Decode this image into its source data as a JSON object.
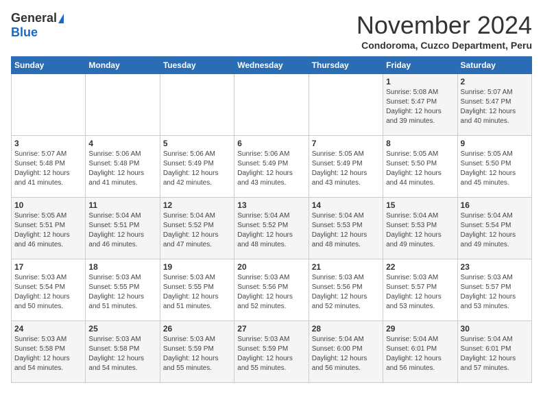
{
  "header": {
    "logo_general": "General",
    "logo_blue": "Blue",
    "month": "November 2024",
    "location": "Condoroma, Cuzco Department, Peru"
  },
  "days_of_week": [
    "Sunday",
    "Monday",
    "Tuesday",
    "Wednesday",
    "Thursday",
    "Friday",
    "Saturday"
  ],
  "weeks": [
    [
      {
        "day": "",
        "info": ""
      },
      {
        "day": "",
        "info": ""
      },
      {
        "day": "",
        "info": ""
      },
      {
        "day": "",
        "info": ""
      },
      {
        "day": "",
        "info": ""
      },
      {
        "day": "1",
        "info": "Sunrise: 5:08 AM\nSunset: 5:47 PM\nDaylight: 12 hours\nand 39 minutes."
      },
      {
        "day": "2",
        "info": "Sunrise: 5:07 AM\nSunset: 5:47 PM\nDaylight: 12 hours\nand 40 minutes."
      }
    ],
    [
      {
        "day": "3",
        "info": "Sunrise: 5:07 AM\nSunset: 5:48 PM\nDaylight: 12 hours\nand 41 minutes."
      },
      {
        "day": "4",
        "info": "Sunrise: 5:06 AM\nSunset: 5:48 PM\nDaylight: 12 hours\nand 41 minutes."
      },
      {
        "day": "5",
        "info": "Sunrise: 5:06 AM\nSunset: 5:49 PM\nDaylight: 12 hours\nand 42 minutes."
      },
      {
        "day": "6",
        "info": "Sunrise: 5:06 AM\nSunset: 5:49 PM\nDaylight: 12 hours\nand 43 minutes."
      },
      {
        "day": "7",
        "info": "Sunrise: 5:05 AM\nSunset: 5:49 PM\nDaylight: 12 hours\nand 43 minutes."
      },
      {
        "day": "8",
        "info": "Sunrise: 5:05 AM\nSunset: 5:50 PM\nDaylight: 12 hours\nand 44 minutes."
      },
      {
        "day": "9",
        "info": "Sunrise: 5:05 AM\nSunset: 5:50 PM\nDaylight: 12 hours\nand 45 minutes."
      }
    ],
    [
      {
        "day": "10",
        "info": "Sunrise: 5:05 AM\nSunset: 5:51 PM\nDaylight: 12 hours\nand 46 minutes."
      },
      {
        "day": "11",
        "info": "Sunrise: 5:04 AM\nSunset: 5:51 PM\nDaylight: 12 hours\nand 46 minutes."
      },
      {
        "day": "12",
        "info": "Sunrise: 5:04 AM\nSunset: 5:52 PM\nDaylight: 12 hours\nand 47 minutes."
      },
      {
        "day": "13",
        "info": "Sunrise: 5:04 AM\nSunset: 5:52 PM\nDaylight: 12 hours\nand 48 minutes."
      },
      {
        "day": "14",
        "info": "Sunrise: 5:04 AM\nSunset: 5:53 PM\nDaylight: 12 hours\nand 48 minutes."
      },
      {
        "day": "15",
        "info": "Sunrise: 5:04 AM\nSunset: 5:53 PM\nDaylight: 12 hours\nand 49 minutes."
      },
      {
        "day": "16",
        "info": "Sunrise: 5:04 AM\nSunset: 5:54 PM\nDaylight: 12 hours\nand 49 minutes."
      }
    ],
    [
      {
        "day": "17",
        "info": "Sunrise: 5:03 AM\nSunset: 5:54 PM\nDaylight: 12 hours\nand 50 minutes."
      },
      {
        "day": "18",
        "info": "Sunrise: 5:03 AM\nSunset: 5:55 PM\nDaylight: 12 hours\nand 51 minutes."
      },
      {
        "day": "19",
        "info": "Sunrise: 5:03 AM\nSunset: 5:55 PM\nDaylight: 12 hours\nand 51 minutes."
      },
      {
        "day": "20",
        "info": "Sunrise: 5:03 AM\nSunset: 5:56 PM\nDaylight: 12 hours\nand 52 minutes."
      },
      {
        "day": "21",
        "info": "Sunrise: 5:03 AM\nSunset: 5:56 PM\nDaylight: 12 hours\nand 52 minutes."
      },
      {
        "day": "22",
        "info": "Sunrise: 5:03 AM\nSunset: 5:57 PM\nDaylight: 12 hours\nand 53 minutes."
      },
      {
        "day": "23",
        "info": "Sunrise: 5:03 AM\nSunset: 5:57 PM\nDaylight: 12 hours\nand 53 minutes."
      }
    ],
    [
      {
        "day": "24",
        "info": "Sunrise: 5:03 AM\nSunset: 5:58 PM\nDaylight: 12 hours\nand 54 minutes."
      },
      {
        "day": "25",
        "info": "Sunrise: 5:03 AM\nSunset: 5:58 PM\nDaylight: 12 hours\nand 54 minutes."
      },
      {
        "day": "26",
        "info": "Sunrise: 5:03 AM\nSunset: 5:59 PM\nDaylight: 12 hours\nand 55 minutes."
      },
      {
        "day": "27",
        "info": "Sunrise: 5:03 AM\nSunset: 5:59 PM\nDaylight: 12 hours\nand 55 minutes."
      },
      {
        "day": "28",
        "info": "Sunrise: 5:04 AM\nSunset: 6:00 PM\nDaylight: 12 hours\nand 56 minutes."
      },
      {
        "day": "29",
        "info": "Sunrise: 5:04 AM\nSunset: 6:01 PM\nDaylight: 12 hours\nand 56 minutes."
      },
      {
        "day": "30",
        "info": "Sunrise: 5:04 AM\nSunset: 6:01 PM\nDaylight: 12 hours\nand 57 minutes."
      }
    ]
  ]
}
